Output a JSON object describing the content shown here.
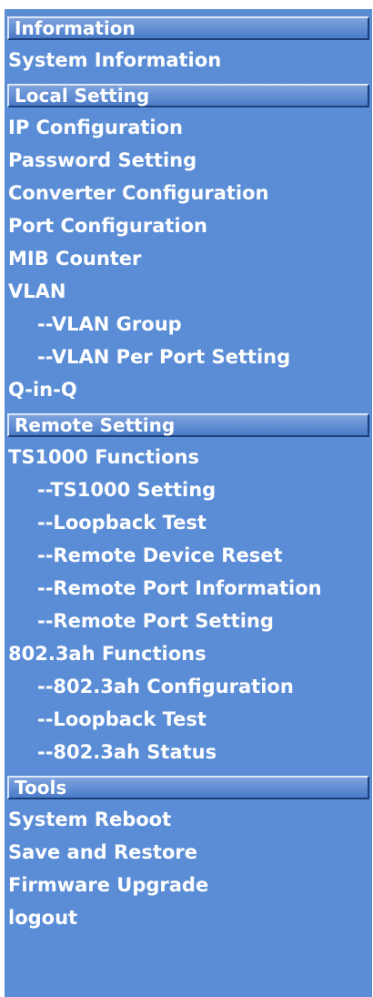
{
  "sidebar": {
    "sections": [
      {
        "header": "Information",
        "items": [
          {
            "label": "System Information",
            "sub": false
          }
        ]
      },
      {
        "header": "Local Setting",
        "items": [
          {
            "label": "IP Configuration",
            "sub": false
          },
          {
            "label": "Password Setting",
            "sub": false
          },
          {
            "label": "Converter Configuration",
            "sub": false
          },
          {
            "label": "Port Configuration",
            "sub": false
          },
          {
            "label": "MIB Counter",
            "sub": false
          },
          {
            "label": "VLAN",
            "sub": false
          },
          {
            "label": "--VLAN Group",
            "sub": true
          },
          {
            "label": "--VLAN Per Port Setting",
            "sub": true
          },
          {
            "label": "Q-in-Q",
            "sub": false
          }
        ]
      },
      {
        "header": "Remote Setting",
        "items": [
          {
            "label": "TS1000 Functions",
            "sub": false
          },
          {
            "label": "--TS1000 Setting",
            "sub": true
          },
          {
            "label": "--Loopback Test",
            "sub": true
          },
          {
            "label": "--Remote Device Reset",
            "sub": true
          },
          {
            "label": "--Remote Port Information",
            "sub": true
          },
          {
            "label": "--Remote Port Setting",
            "sub": true
          },
          {
            "label": "802.3ah Functions",
            "sub": false
          },
          {
            "label": "--802.3ah Configuration",
            "sub": true
          },
          {
            "label": "--Loopback Test",
            "sub": true
          },
          {
            "label": "--802.3ah Status",
            "sub": true
          }
        ]
      },
      {
        "header": "Tools",
        "items": [
          {
            "label": "System Reboot",
            "sub": false
          },
          {
            "label": "Save and Restore",
            "sub": false
          },
          {
            "label": "Firmware Upgrade",
            "sub": false
          },
          {
            "label": "logout",
            "sub": false
          }
        ]
      }
    ]
  }
}
